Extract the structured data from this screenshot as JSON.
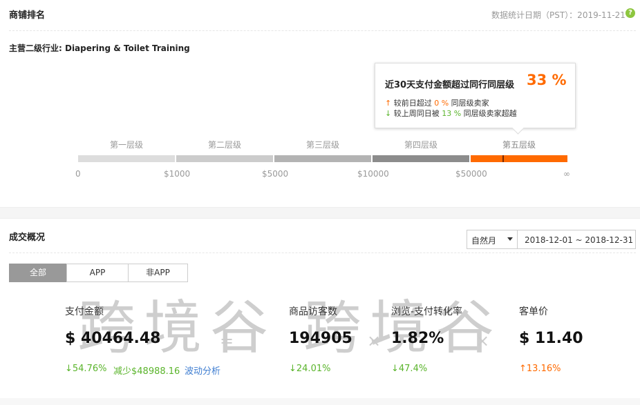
{
  "header": {
    "title": "商铺排名",
    "stat_date": "数据统计日期（PST）：2019-11-21",
    "help_icon": "question-circle-icon"
  },
  "industry": {
    "label": "主营二级行业: Diapering & Toilet Training"
  },
  "tooltip": {
    "title": "近30天支付金额超过同行同层级",
    "percent": "33 %",
    "line1_arrow": "↑",
    "line1_prefix": "较前日超过",
    "line1_value": "0 %",
    "line1_suffix": "同层级卖家",
    "line2_arrow": "↓",
    "line2_prefix": "较上周同日被",
    "line2_value": "13 %",
    "line2_suffix": "同层级卖家超越"
  },
  "tiers": {
    "labels": [
      "第一层级",
      "第二层级",
      "第三层级",
      "第四层级",
      "第五层级"
    ],
    "colors": [
      "#dddddd",
      "#cccccc",
      "#b3b3b3",
      "#8c8c8c",
      "#ff6a00"
    ],
    "active_index": 4,
    "ticks": [
      "0",
      "$1000",
      "$5000",
      "$10000",
      "$50000",
      "∞"
    ],
    "marker_fraction": 0.33
  },
  "deal": {
    "title": "成交概况",
    "period_select": "自然月",
    "date_range": "2018-12-01 ~ 2018-12-31",
    "segments": [
      "全部",
      "APP",
      "非APP"
    ],
    "active_segment": 0
  },
  "metrics": [
    {
      "label": "支付金额",
      "value": "$ 40464.48"
    },
    {
      "label": "商品访客数",
      "value": "194905"
    },
    {
      "label": "浏览-支付转化率",
      "value": "1.82%"
    },
    {
      "label": "客单价",
      "value": "$ 11.40"
    }
  ],
  "metric_subs": {
    "pay_change": "↓54.76%",
    "pay_reduce": "减少$48988.16",
    "pay_link": "波动分析",
    "visitors_change": "↓24.01%",
    "conversion_change": "↓47.4%",
    "avg_order_change": "↑13.16%"
  },
  "operators": [
    "=",
    "×",
    "×"
  ],
  "watermark": "跨境谷 跨境谷",
  "colors": {
    "accent": "#ff6a00",
    "positive": "#5ab42b",
    "link": "#3f7ed1"
  }
}
